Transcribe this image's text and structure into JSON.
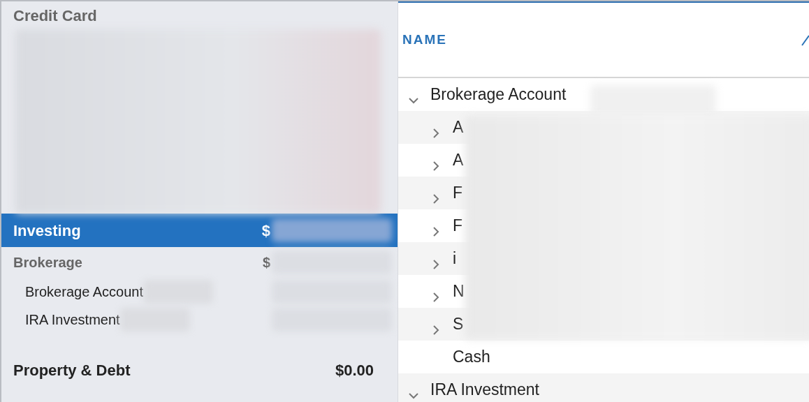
{
  "sidebar": {
    "rows": [
      {
        "kind": "category",
        "label": "Credit Card",
        "selected": false
      },
      {
        "kind": "group",
        "label": "Investing",
        "amount": "$",
        "selected": true
      },
      {
        "kind": "subgroup",
        "label": "Brokerage",
        "amount": "$",
        "selected": false
      },
      {
        "kind": "account",
        "label": "Brokerage Account",
        "selected": false
      },
      {
        "kind": "account",
        "label": "IRA Investment",
        "selected": false
      },
      {
        "kind": "group",
        "label": "Property & Debt",
        "amount": "$0.00",
        "selected": false
      }
    ]
  },
  "table": {
    "columns": [
      "NAME"
    ],
    "rows": [
      {
        "name": "Brokerage Account",
        "expanded": true,
        "children": [
          {
            "name": "A",
            "expanded": false
          },
          {
            "name": "A",
            "expanded": false
          },
          {
            "name": "F",
            "expanded": false
          },
          {
            "name": "F",
            "expanded": false
          },
          {
            "name": "i",
            "expanded": false
          },
          {
            "name": "N",
            "expanded": false
          },
          {
            "name": "S",
            "expanded": false
          },
          {
            "name": "Cash"
          }
        ]
      },
      {
        "name": "IRA Investment",
        "expanded": true
      }
    ]
  }
}
